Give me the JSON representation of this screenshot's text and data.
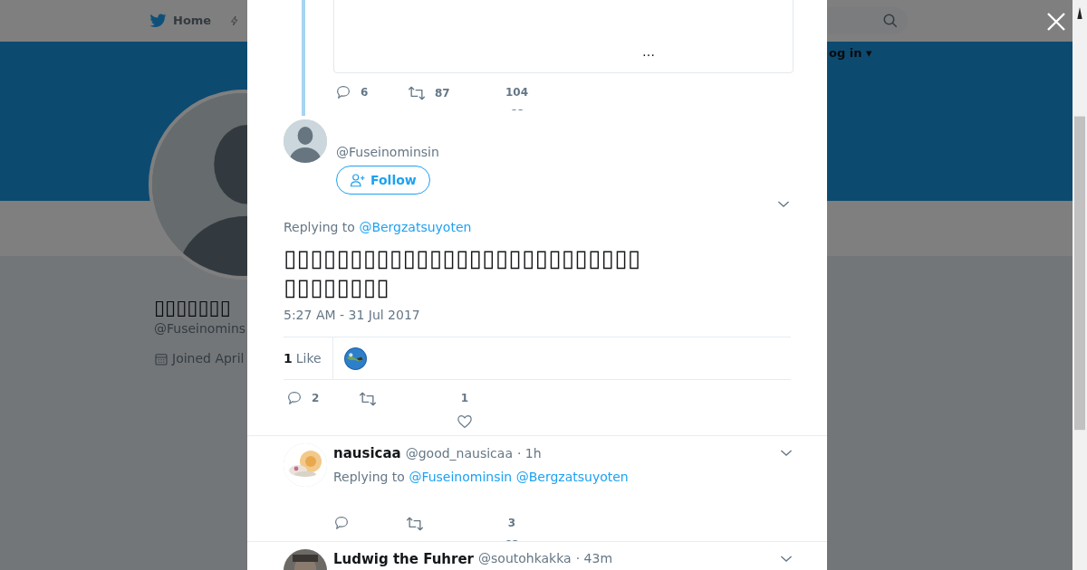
{
  "background_page": {
    "nav": {
      "home": "Home",
      "login": "og in ▾"
    },
    "profile": {
      "name": "▯▯▯▯▯▯▯",
      "handle": "@Fuseinomins",
      "joined": "Joined April"
    }
  },
  "modal": {
    "parent_tweet": {
      "quote_ellipsis": "…",
      "actions": {
        "replies": "6",
        "retweets": "87",
        "likes": "104"
      }
    },
    "tweet": {
      "handle": "@Fuseinominsin",
      "follow_label": "Follow",
      "replying_label": "Replying to",
      "replying_to": [
        "@Bergzatsuyoten"
      ],
      "text_lines": [
        "▯▯▯▯▯▯▯▯▯▯▯▯▯▯▯▯▯▯▯▯▯▯▯▯▯▯▯",
        "▯▯▯▯▯▯▯▯"
      ],
      "timestamp": "5:27 AM - 31 Jul 2017",
      "like_total": "1",
      "like_label": "Like",
      "actions": {
        "replies": "2",
        "likes": "1"
      }
    },
    "replies": [
      {
        "name": "nausicaa",
        "handle": "@good_nausicaa",
        "time": "· 1h",
        "replying_label": "Replying to",
        "replying_to": [
          "@Fuseinominsin",
          "@Bergzatsuyoten"
        ],
        "actions": {
          "likes": "3"
        }
      },
      {
        "name": "Ludwig the Fuhrer",
        "handle": "@soutohkakka",
        "time": "· 43m"
      }
    ]
  }
}
